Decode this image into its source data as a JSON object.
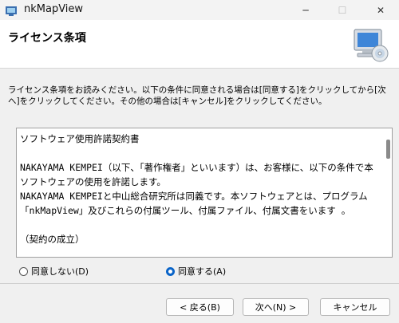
{
  "window": {
    "title": "nkMapView",
    "minimize_icon": "minimize-icon",
    "maximize_icon": "maximize-icon",
    "close_icon": "close-icon",
    "minimize_glyph": "─",
    "maximize_glyph": "☐",
    "close_glyph": "✕"
  },
  "header": {
    "title": "ライセンス条項",
    "image": "installer-computer-cd-icon"
  },
  "instructions": "ライセンス条項をお読みください。以下の条件に同意される場合は[同意する]をクリックしてから[次へ]をクリックしてください。その他の場合は[キャンセル]をクリックしてください。",
  "license": {
    "text": "ソフトウェア使用許諾契約書\n\nNAKAYAMA KEMPEI（以下、「著作権者」といいます）は、お客様に、以下の条件で本ソフトウェアの使用を許諾します。\nNAKAYAMA KEMPEIと中山総合研究所は同義です。本ソフトウェアとは、プログラム「nkMapView」及びこれらの付属ツール、付属ファイル、付属文書をいます 。\n\n（契約の成立）"
  },
  "options": {
    "disagree_label": "同意しない(D)",
    "agree_label": "同意する(A)",
    "selected": "agree"
  },
  "buttons": {
    "back": "< 戻る(B)",
    "next": "次へ(N) >",
    "cancel": "キャンセル"
  },
  "colors": {
    "accent": "#0a64c8"
  }
}
